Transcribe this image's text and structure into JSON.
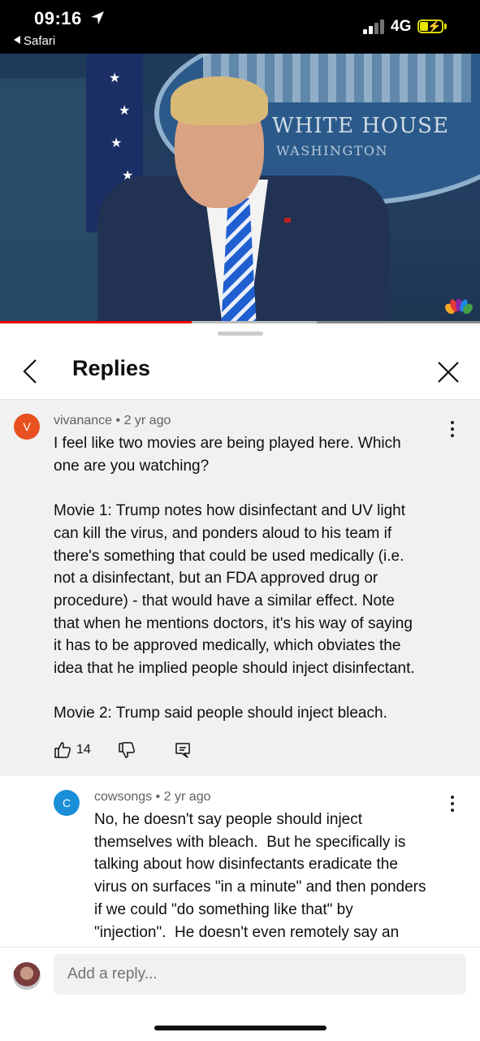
{
  "status_bar": {
    "time": "09:16",
    "back_app": "Safari",
    "network": "4G"
  },
  "video": {
    "backdrop_line1": "WHITE HOUSE",
    "backdrop_line2": "WASHINGTON",
    "progress_played_fraction": 0.4,
    "progress_buffered_fraction": 0.66
  },
  "header": {
    "title": "Replies"
  },
  "top_comment": {
    "avatar_letter": "V",
    "avatar_color": "#e8501f",
    "author": "vivanance",
    "age": "2 yr ago",
    "text": "I feel like two movies are being played here. Which\none are you watching?\n\nMovie 1: Trump notes how disinfectant and UV light\ncan kill the virus, and ponders aloud to his team if\nthere's something that could be used medically (i.e.\nnot a disinfectant, but an FDA approved drug or\nprocedure) - that would have a similar effect. Note\nthat when he mentions doctors, it's his way of saying\nit has to be approved medically, which obviates the\nidea that he implied people should inject disinfectant.\n\nMovie 2: Trump said people should inject bleach.",
    "like_count": "14"
  },
  "reply": {
    "avatar_letter": "C",
    "avatar_color": "#1a8fd8",
    "author": "cowsongs",
    "age": "2 yr ago",
    "text": "No, he doesn't say people should inject\nthemselves with bleach.  But he specifically is\ntalking about how disinfectants eradicate the\nvirus on surfaces \"in a minute\" and then ponders\nif we could \"do something like that\" by\n\"injection\".  He doesn't even remotely say an"
  },
  "composer": {
    "placeholder": "Add a reply..."
  },
  "separator": "•"
}
